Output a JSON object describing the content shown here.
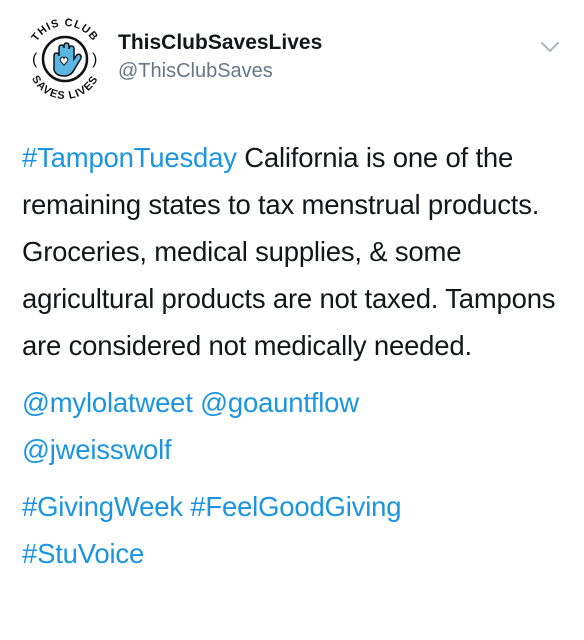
{
  "header": {
    "avatar": {
      "logo_top_text": "THIS CLUB",
      "logo_bottom_text": "SAVES LIVES",
      "colors": {
        "ring": "#111111",
        "hand": "#5bb6e6",
        "heart": "#ffffff"
      }
    },
    "display_name": "ThisClubSavesLives",
    "handle": "@ThisClubSaves",
    "menu_icon": "chevron-down-icon"
  },
  "tweet": {
    "line1_hashtag": "#TamponTuesday",
    "line1_text": " California is one of the remaining states to tax menstrual products. Groceries, medical supplies, & some agricultural products are not taxed. Tampons are considered not medically needed.",
    "mentions": [
      "@mylolatweet",
      "@goauntflow",
      "@jweisswolf"
    ],
    "hashtags": [
      "#GivingWeek",
      "#FeelGoodGiving",
      "#StuVoice"
    ]
  },
  "colors": {
    "text": "#14171a",
    "secondary": "#657786",
    "link": "#1b95e0"
  }
}
